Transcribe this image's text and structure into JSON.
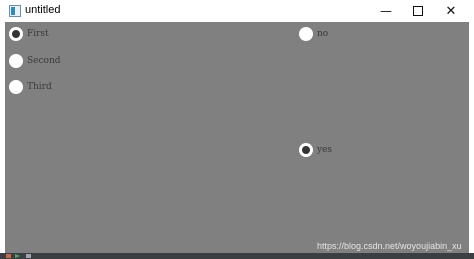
{
  "window": {
    "title": "untitled",
    "controls": {
      "minimize": "—",
      "close": "✕"
    }
  },
  "radios": {
    "first": {
      "label": "First",
      "checked": true
    },
    "second": {
      "label": "Second",
      "checked": false
    },
    "third": {
      "label": "Third",
      "checked": false
    },
    "no": {
      "label": "no",
      "checked": false
    },
    "yes": {
      "label": "yes",
      "checked": true
    }
  },
  "watermark": "https://blog.csdn.net/woyoujiabin_xu",
  "colors": {
    "content_background": "#808080",
    "radio_fill": "#ffffff",
    "radio_checked_dot": "#333333"
  }
}
